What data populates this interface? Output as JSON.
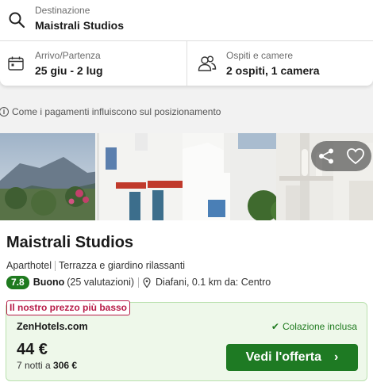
{
  "search": {
    "destination_label": "Destinazione",
    "destination_value": "Maistrali Studios",
    "dates_label": "Arrivo/Partenza",
    "dates_value": "25 giu - 2 lug",
    "guests_label": "Ospiti e camere",
    "guests_value": "2 ospiti, 1 camera"
  },
  "payment_note": "Come i pagamenti influiscono sul posizionamento",
  "hotel": {
    "name": "Maistrali Studios",
    "type": "Aparthotel",
    "feature": "Terrazza e giardino rilassanti",
    "score": "7.8",
    "rating_word": "Buono",
    "reviews": "(25 valutazioni)",
    "location": "Diafani, 0.1 km da: Centro"
  },
  "offer": {
    "badge": "Il nostro prezzo più basso",
    "provider": "ZenHotels.com",
    "included": "Colazione inclusa",
    "price": "44 €",
    "nights_prefix": "7 notti a",
    "total": "306 €",
    "cta_label": "Vedi l'offerta"
  },
  "colors": {
    "accent_green": "#1e7a23",
    "badge_red": "#b71c48",
    "offer_bg": "#eef8ea"
  },
  "icons": [
    "search-icon",
    "calendar-icon",
    "guests-icon",
    "info-icon",
    "share-icon",
    "heart-icon",
    "location-pin-icon",
    "check-icon",
    "chevron-right-icon"
  ]
}
